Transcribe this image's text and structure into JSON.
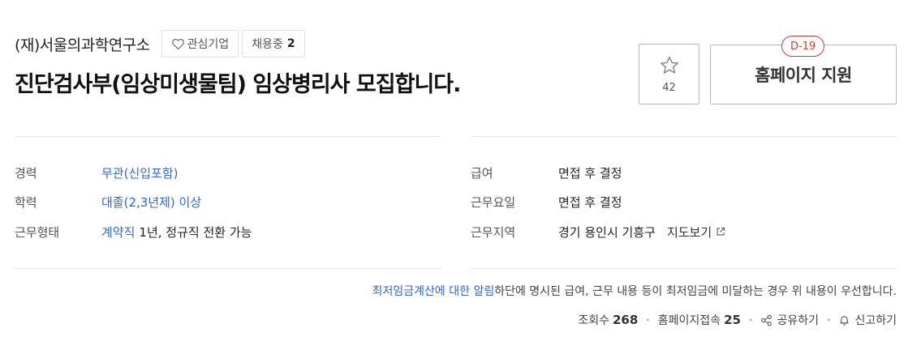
{
  "company": {
    "name": "(재)서울의과학연구소",
    "favorite_label": "관심기업",
    "hiring_label": "채용중",
    "hiring_count": "2"
  },
  "job": {
    "title": "진단검사부(임상미생물팀) 임상병리사 모집합니다."
  },
  "actions": {
    "star_count": "42",
    "apply_label": "홈페이지 지원",
    "dday": "D-19"
  },
  "conditions_left": [
    {
      "label": "경력",
      "value": "무관(신입포함)"
    },
    {
      "label": "학력",
      "value": "대졸(2,3년제) 이상"
    },
    {
      "label": "근무형태",
      "value_link": "계약직",
      "value_text": "1년, 정규직 전환 가능"
    }
  ],
  "conditions_right": [
    {
      "label": "급여",
      "value": "면접 후 결정"
    },
    {
      "label": "근무요일",
      "value": "면접 후 결정"
    },
    {
      "label": "근무지역",
      "value": "경기 용인시 기흥구",
      "map_label": "지도보기"
    }
  ],
  "notice": {
    "link_text": "최저임금계산에 대한 알림",
    "text": "하단에 명시된 급여, 근무 내용 등이 최저임금에 미달하는 경우 위 내용이 우선합니다."
  },
  "footer": {
    "views_label": "조회수",
    "views_count": "268",
    "homepage_visits_label": "홈페이지접속",
    "homepage_visits_count": "25",
    "share_label": "공유하기",
    "report_label": "신고하기"
  },
  "colors": {
    "link": "#3165d4",
    "dday": "#e0342b"
  }
}
